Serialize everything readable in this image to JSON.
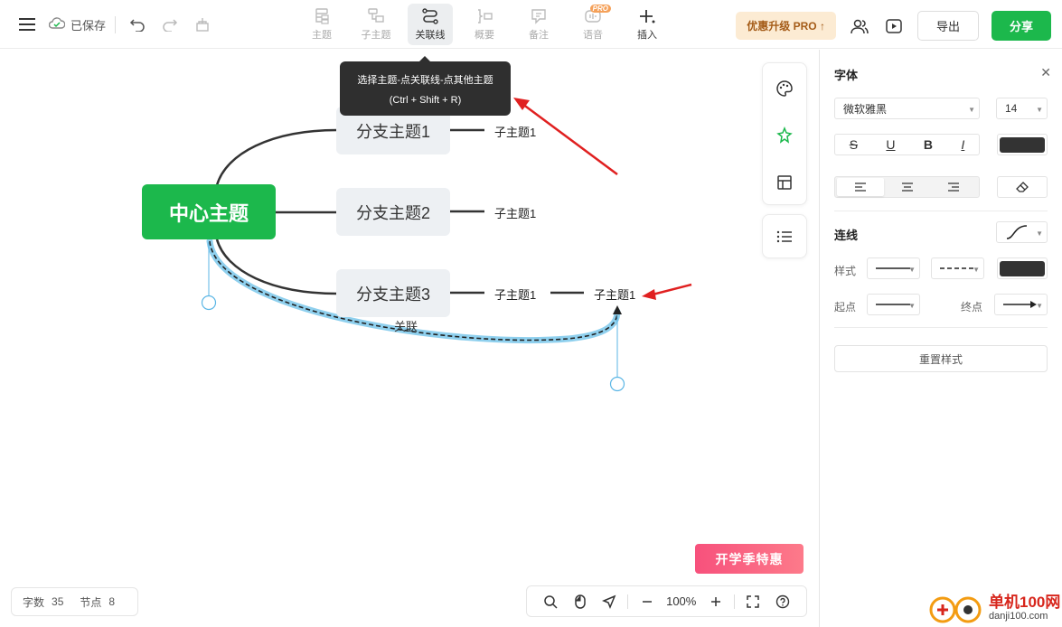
{
  "topbar": {
    "saved_label": "已保存",
    "tools": [
      {
        "label": "主题",
        "icon": "topic-icon"
      },
      {
        "label": "子主题",
        "icon": "subtopic-icon"
      },
      {
        "label": "关联线",
        "icon": "relation-line-icon"
      },
      {
        "label": "概要",
        "icon": "summary-icon"
      },
      {
        "label": "备注",
        "icon": "note-icon"
      },
      {
        "label": "语音",
        "icon": "voice-icon",
        "badge": "PRO"
      },
      {
        "label": "插入",
        "icon": "insert-plus-icon"
      }
    ],
    "upgrade_label": "优惠升级 PRO ↑",
    "export_label": "导出",
    "share_label": "分享"
  },
  "tooltip": {
    "line1": "选择主题-点关联线-点其他主题",
    "line2": "(Ctrl + Shift + R)"
  },
  "mindmap": {
    "center": "中心主题",
    "branches": [
      {
        "label": "分支主题1",
        "subs": [
          "子主题1"
        ]
      },
      {
        "label": "分支主题2",
        "subs": [
          "子主题1"
        ]
      },
      {
        "label": "分支主题3",
        "subs": [
          "子主题1",
          "子主题1"
        ]
      }
    ],
    "relation_label": "关联"
  },
  "promo_label": "开学季特惠",
  "stats": {
    "words_label": "字数",
    "words_value": "35",
    "nodes_label": "节点",
    "nodes_value": "8"
  },
  "zoom": {
    "value": "100%"
  },
  "panel": {
    "font_title": "字体",
    "font_family": "微软雅黑",
    "font_size": "14",
    "line_title": "连线",
    "style_label": "样式",
    "start_label": "起点",
    "end_label": "终点",
    "reset_label": "重置样式"
  },
  "watermark": {
    "site": "单机100网",
    "url": "danji100.com"
  },
  "colors": {
    "accent": "#1cb84c",
    "relation_highlight": "#8fd0ee",
    "arrow_red": "#e02020"
  }
}
